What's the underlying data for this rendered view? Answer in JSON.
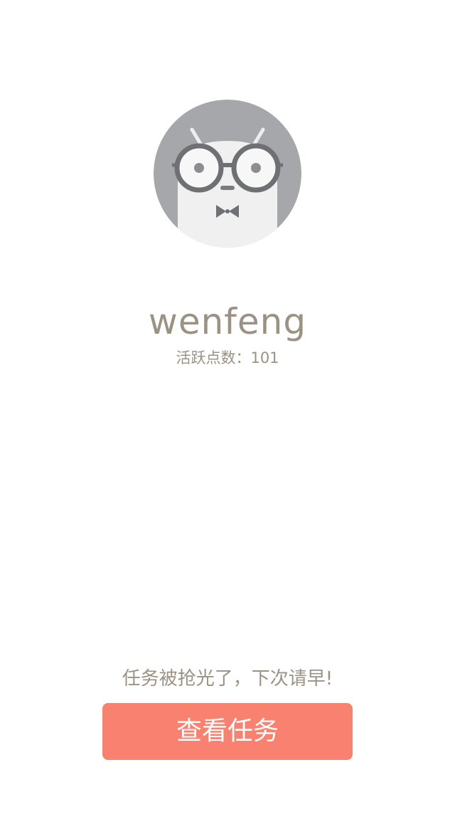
{
  "profile": {
    "username": "wenfeng",
    "activity_label": "活跃点数：",
    "activity_points": "101",
    "avatar_icon": "nerd-robot-avatar-icon"
  },
  "tasks": {
    "empty_message": "任务被抢光了，下次请早!",
    "view_button_label": "查看任务"
  },
  "colors": {
    "background": "#ffffff",
    "text_muted": "#9c9283",
    "accent": "#f98170",
    "avatar_bg": "#a6a7ab"
  }
}
